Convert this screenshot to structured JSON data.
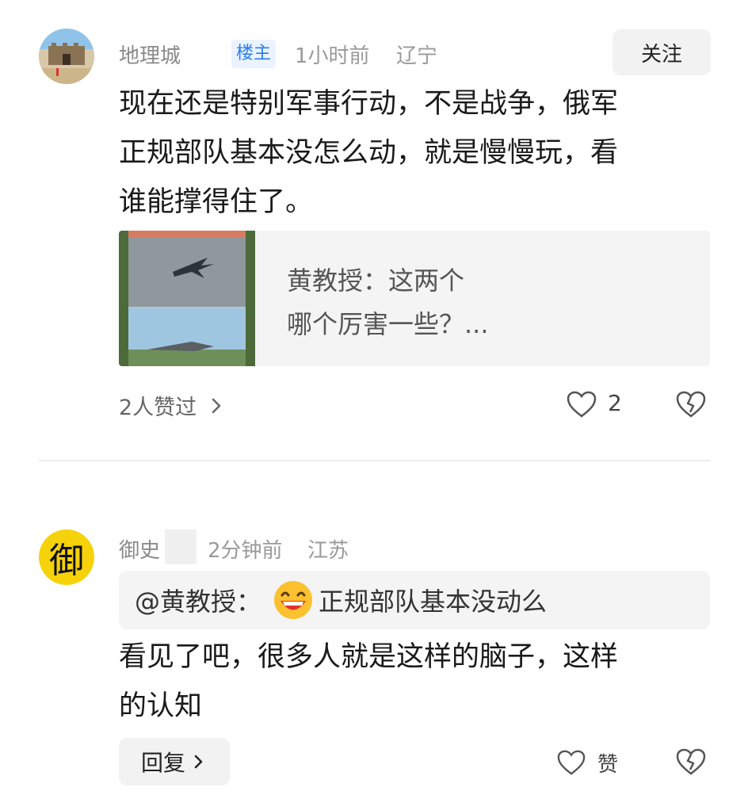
{
  "comment1": {
    "username": "地理城",
    "op_badge": "楼主",
    "time": "1小时前",
    "location": "辽宁",
    "follow_label": "关注",
    "text_lines": [
      "现在还是特别军事行动，不是战争，俄军",
      "正规部队基本没怎么动，就是慢慢玩，看",
      "谁能撑得住了。"
    ],
    "quote": {
      "line1": "黄教授：这两个",
      "line2": "哪个厉害一些？..."
    },
    "liked_by": "2人赞过",
    "like_count": "2"
  },
  "comment2": {
    "avatar_char": "御",
    "username": "御史",
    "time": "2分钟前",
    "location": "江苏",
    "quote_prefix": "@黄教授：",
    "quote_text": "正规部队基本没动么",
    "text_lines": [
      "看见了吧，很多人就是这样的脑子，这样",
      "的认知"
    ],
    "reply_label": "回复",
    "like_label": "赞"
  },
  "colors": {
    "accent_blue": "#2b7bea",
    "avatar_yellow": "#f5d20a"
  },
  "icons": [
    "heart-outline-icon",
    "dislike-heart-icon",
    "chevron-right-icon",
    "grin-emoji-icon"
  ]
}
